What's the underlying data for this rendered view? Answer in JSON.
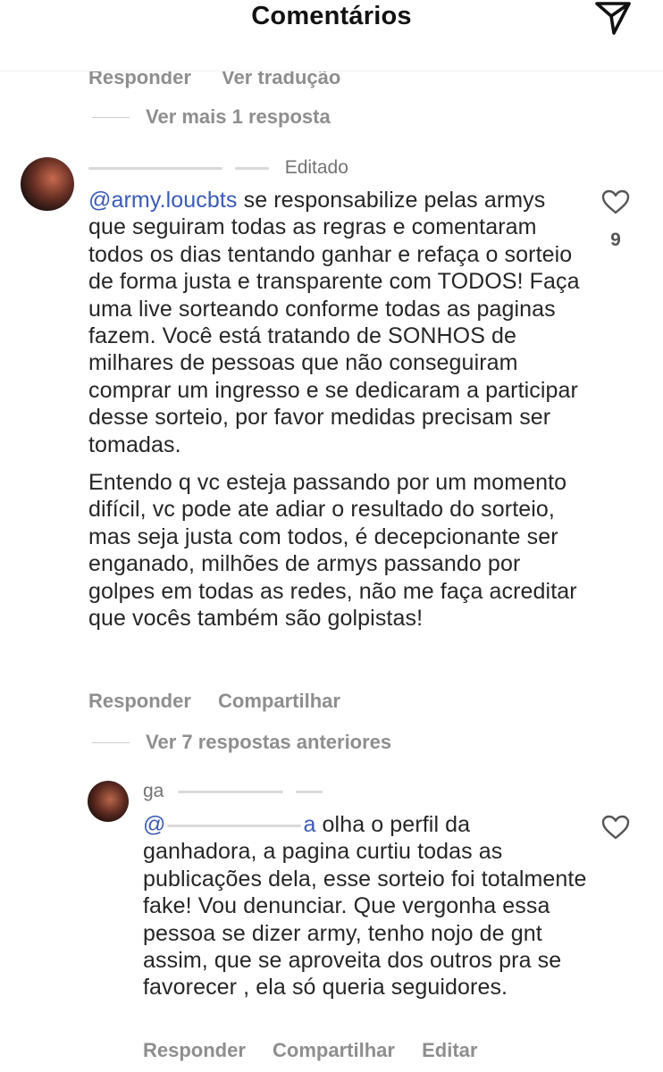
{
  "header": {
    "title": "Comentários",
    "send_icon": "send-icon"
  },
  "previous_comment": {
    "actions": [
      "Responder",
      "Ver tradução"
    ],
    "more_replies": "Ver mais 1 resposta"
  },
  "comment_1": {
    "username_visible": "Editado",
    "mention": "@army.loucbts",
    "paragraph_1_rest": " se responsabilize pelas armys que seguiram todas as regras e comentaram todos os dias tentando ganhar e refaça o sorteio de forma justa e transparente com TODOS! Faça uma live sorteando conforme todas as paginas fazem. Você está tratando de SONHOS de milhares de pessoas que não conseguiram comprar um ingresso e se dedicaram a participar desse sorteio, por favor medidas precisam ser tomadas.",
    "paragraph_2": "Entendo q vc esteja passando por um momento difícil, vc pode ate adiar o resultado do sorteio, mas seja justa com todos, é decepcionante ser enganado, milhões de armys passando por golpes em todas as redes, não me faça acreditar que vocês também são golpistas!",
    "like_icon": "heart-outline-icon",
    "like_count": "9",
    "actions": [
      "Responder",
      "Compartilhar"
    ],
    "replies_link": "Ver 7 respostas anteriores"
  },
  "comment_2": {
    "username_visible": "ga",
    "mention_visible": "@",
    "mention_tail": "a",
    "text_rest": " olha o perfil da ganhadora, a pagina curtiu todas as publicações dela, esse sorteio foi totalmente fake! Vou denunciar. Que vergonha essa pessoa se dizer army, tenho nojo de gnt assim, que se aproveita dos outros pra se favorecer , ela só queria seguidores.",
    "like_icon": "heart-outline-icon",
    "actions": [
      "Responder",
      "Compartilhar",
      "Editar"
    ]
  }
}
